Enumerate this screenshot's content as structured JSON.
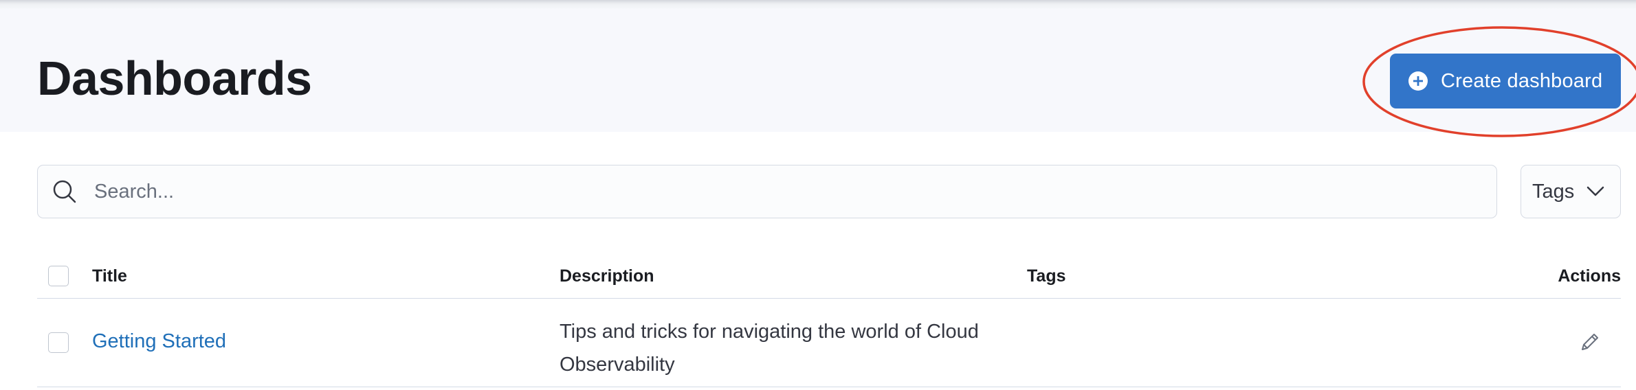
{
  "page": {
    "title": "Dashboards",
    "create_button_label": "Create dashboard",
    "annotation_color": "#e1402b"
  },
  "search": {
    "placeholder": "Search...",
    "value": ""
  },
  "filters": {
    "tags_label": "Tags"
  },
  "table": {
    "columns": [
      "Title",
      "Description",
      "Tags",
      "Actions"
    ],
    "rows": [
      {
        "title": "Getting Started",
        "description": "Tips and tricks for navigating the world of Cloud Observability",
        "tags": "",
        "actions": [
          "pencil-icon"
        ]
      }
    ]
  },
  "colors": {
    "primary": "#3275c9",
    "link": "#1f6fb8",
    "header_bg": "#f7f8fc"
  }
}
